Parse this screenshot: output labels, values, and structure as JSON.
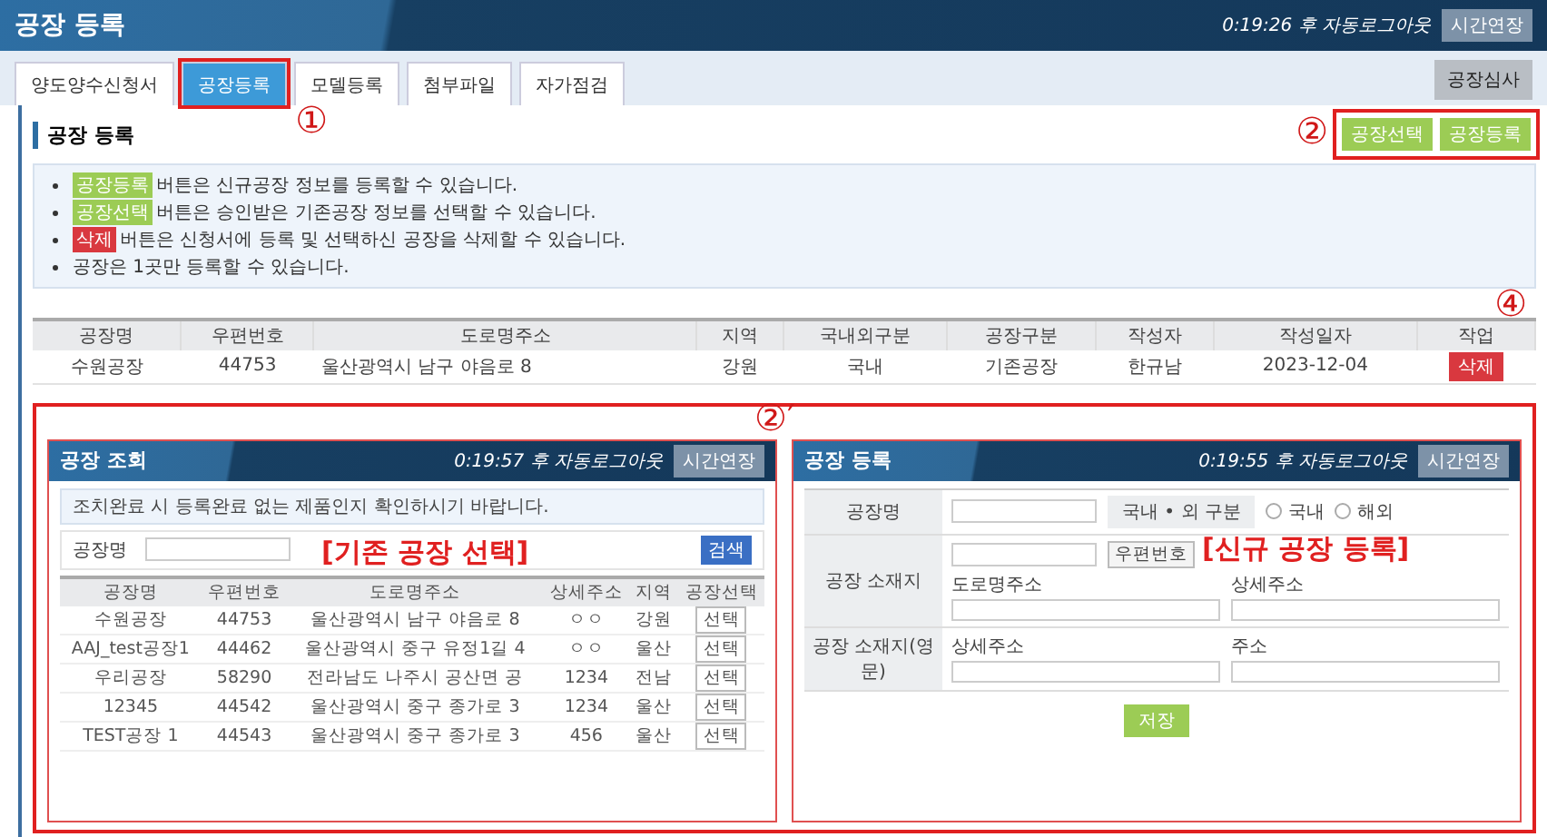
{
  "header": {
    "title": "공장 등록",
    "timer": "0:19:26 후 자동로그아웃",
    "extend_button": "시간연장"
  },
  "tabs": [
    {
      "label": "양도양수신청서",
      "selected": false,
      "annotated": false
    },
    {
      "label": "공장등록",
      "selected": true,
      "annotated": true,
      "marker": "①"
    },
    {
      "label": "모델등록",
      "selected": false,
      "annotated": false
    },
    {
      "label": "첨부파일",
      "selected": false,
      "annotated": false
    },
    {
      "label": "자가점검",
      "selected": false,
      "annotated": false
    }
  ],
  "right_button": "공장심사",
  "section": {
    "title": "공장 등록",
    "marker": "②",
    "annotated": true,
    "buttons": [
      "공장선택",
      "공장등록"
    ]
  },
  "notes": [
    {
      "badge": "공장등록",
      "color": "#9ccc55",
      "text": "버튼은 신규공장 정보를 등록할 수 있습니다."
    },
    {
      "badge": "공장선택",
      "color": "#9ccc55",
      "text": "버튼은 승인받은 기존공장 정보를 선택할 수 있습니다."
    },
    {
      "badge": "삭제",
      "color": "#d9383f",
      "text": "버튼은 신청서에 등록 및 선택하신 공장을 삭제할 수 있습니다."
    },
    {
      "text": "공장은 1곳만 등록할 수 있습니다."
    }
  ],
  "table": {
    "marker": "④",
    "columns": [
      "공장명",
      "우편번호",
      "도로명주소",
      "지역",
      "국내외구분",
      "공장구분",
      "작성자",
      "작성일자",
      "작업"
    ],
    "rows": [
      {
        "cells": [
          "수원공장",
          "44753",
          "울산광역시 남구 야음로 8",
          "강원",
          "국내",
          "기존공장",
          "한규남",
          "2023-12-04"
        ],
        "action": "삭제"
      }
    ]
  },
  "previews": {
    "marker": "②′",
    "select_dialog": {
      "title": "공장 조회",
      "timer": "0:19:57 후 자동로그아웃",
      "extend_button": "시간연장",
      "notice": "조치완료 시 등록완료 없는 제품인지 확인하시기 바랍니다.",
      "search_label": "공장명",
      "search_button": "검색",
      "caption": "[기존 공장 선택]",
      "columns": [
        "공장명",
        "우편번호",
        "도로명주소",
        "상세주소",
        "지역",
        "공장선택"
      ],
      "rows": [
        {
          "cells": [
            "수원공장",
            "44753",
            "울산광역시 남구 야음로 8",
            "ㅇㅇ",
            "강원"
          ],
          "action": "선택"
        },
        {
          "cells": [
            "AAJ_test공장1",
            "44462",
            "울산광역시 중구 유정1길 4",
            "ㅇㅇ",
            "울산"
          ],
          "action": "선택"
        },
        {
          "cells": [
            "우리공장",
            "58290",
            "전라남도 나주시 공산면 공",
            "1234",
            "전남"
          ],
          "action": "선택"
        },
        {
          "cells": [
            "12345",
            "44542",
            "울산광역시 중구 종가로 3",
            "1234",
            "울산"
          ],
          "action": "선택"
        },
        {
          "cells": [
            "TEST공장 1",
            "44543",
            "울산광역시 중구 종가로 3",
            "456",
            "울산"
          ],
          "action": "선택"
        }
      ]
    },
    "register_dialog": {
      "title": "공장 등록",
      "timer": "0:19:55 후 자동로그아웃",
      "extend_button": "시간연장",
      "caption": "[신규 공장 등록]",
      "name_label": "공장명",
      "origin_label": "국내 • 외 구분",
      "origin_options": [
        {
          "label": "국내",
          "selected": false
        },
        {
          "label": "해외",
          "selected": false
        }
      ],
      "location_label": "공장 소재지",
      "postcode_button": "우편번호",
      "road_label": "도로명주소",
      "detail_label": "상세주소",
      "english_label": "공장 소재지(영문)",
      "english_fields": [
        "상세주소",
        "주소"
      ],
      "save_button": "저장"
    }
  }
}
